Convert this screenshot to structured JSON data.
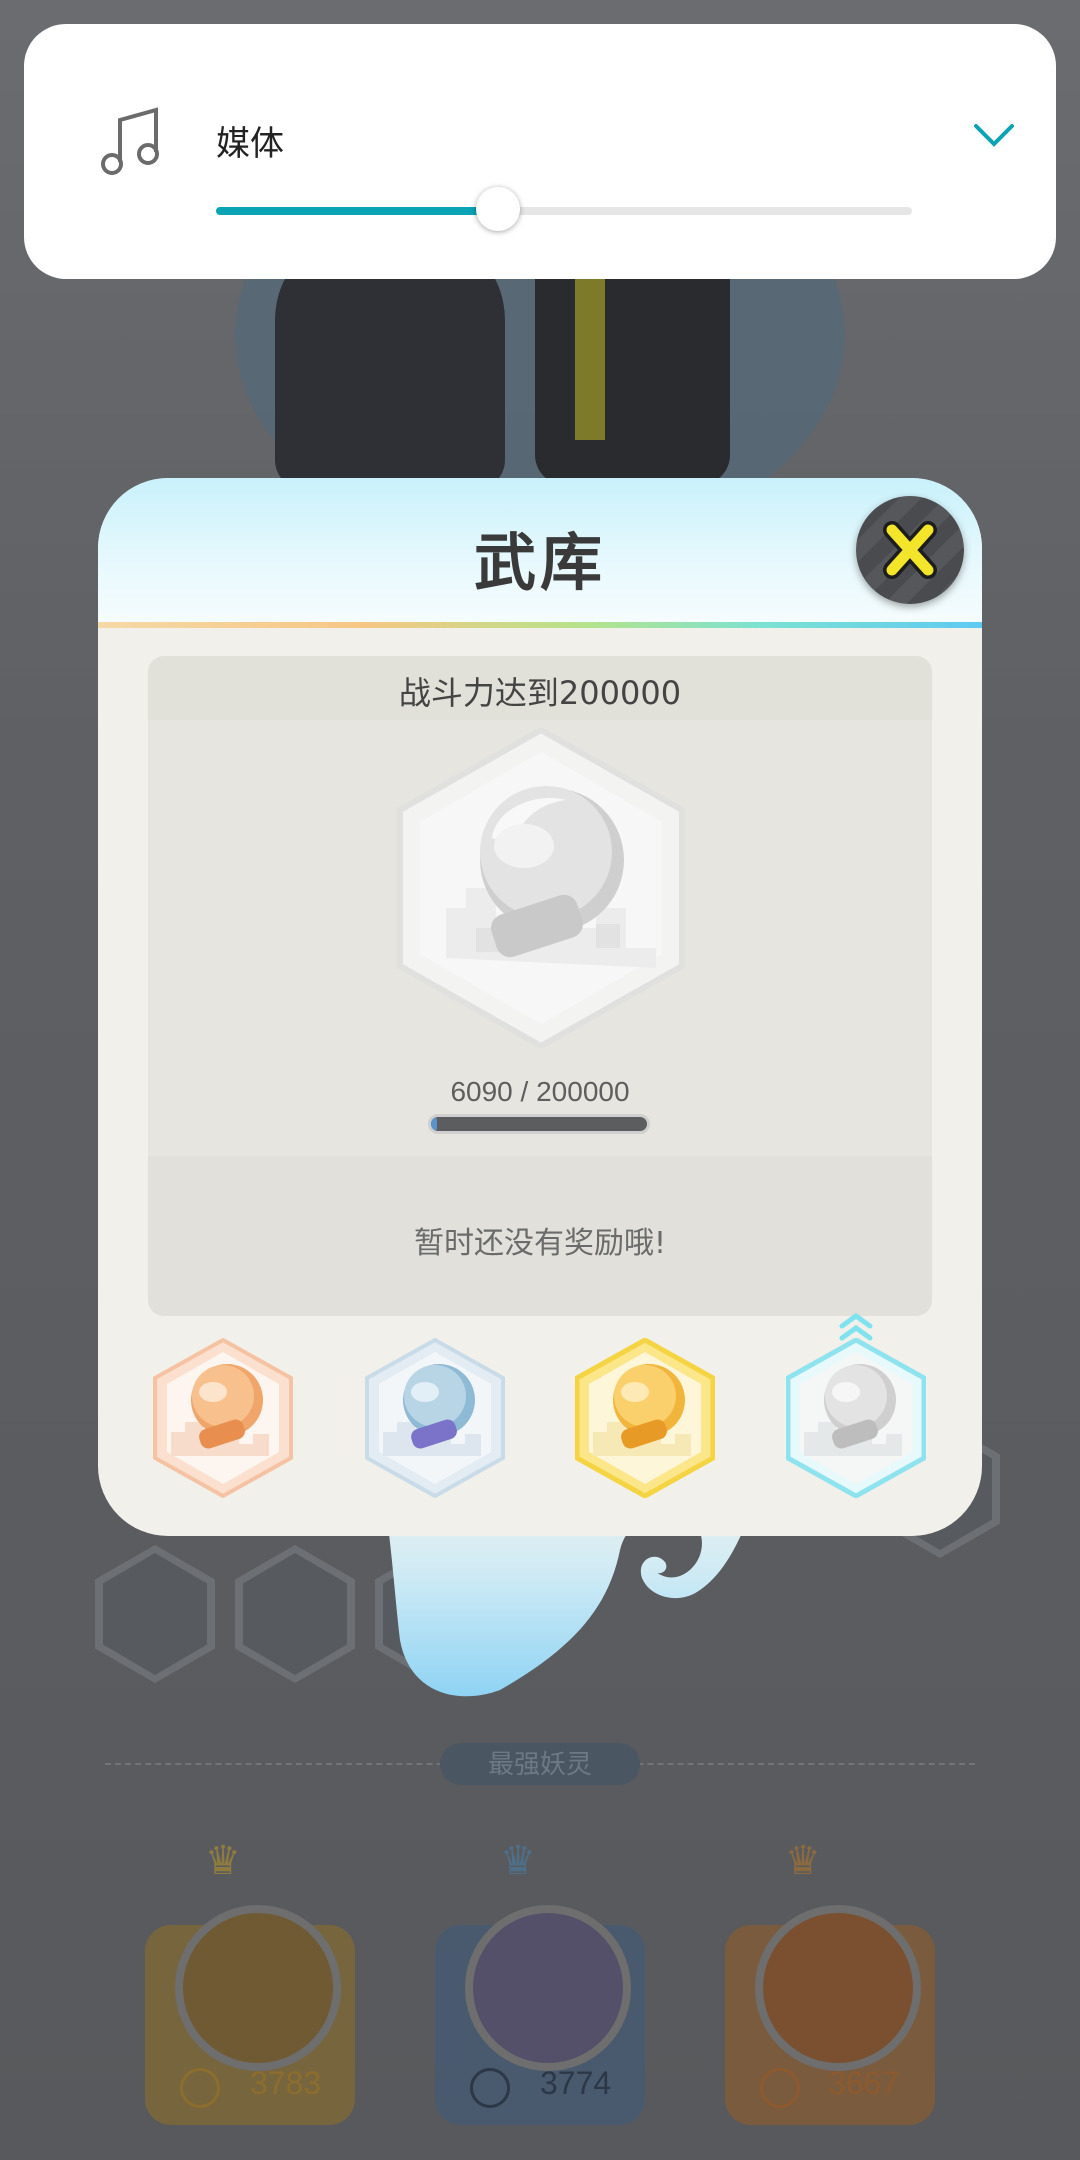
{
  "volume_panel": {
    "icon": "music-note-icon",
    "label": "媒体",
    "level": 0.405,
    "expand_icon": "chevron-down-icon",
    "accent_color": "#0aa4b5"
  },
  "dialog": {
    "title": "武库",
    "close_icon": "close-icon",
    "goal": "战斗力达到200000",
    "progress_text": "6090 / 200000",
    "progress_fraction": 0.03,
    "reward_text": "暂时还没有奖励哦!",
    "tiers": [
      {
        "name": "bronze",
        "color": "#f0a56a"
      },
      {
        "name": "silver",
        "color": "#8fbad6"
      },
      {
        "name": "gold",
        "color": "#f2b53c"
      },
      {
        "name": "diamond",
        "color": "#9fe9f2"
      }
    ]
  },
  "background": {
    "section_label": "最强妖灵",
    "leaders": [
      {
        "value": "3783"
      },
      {
        "value": "3774"
      },
      {
        "value": "3667"
      }
    ]
  }
}
